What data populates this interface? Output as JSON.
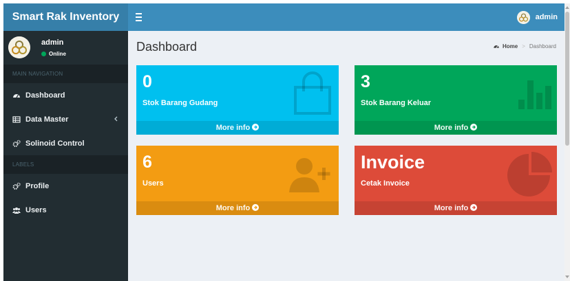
{
  "header": {
    "logo": "Smart Rak Inventory",
    "user_name": "admin"
  },
  "sidebar": {
    "user_name": "admin",
    "user_status": "Online",
    "sections": [
      {
        "title": "MAIN NAVIGATION"
      },
      {
        "title": "LABELS"
      }
    ],
    "items": [
      {
        "label": "Dashboard",
        "icon": "dashboard-icon"
      },
      {
        "label": "Data Master",
        "icon": "table-icon"
      },
      {
        "label": "Solinoid Control",
        "icon": "cogs-icon"
      },
      {
        "label": "Profile",
        "icon": "cogs-icon"
      },
      {
        "label": "Users",
        "icon": "users-icon"
      }
    ]
  },
  "content": {
    "title": "Dashboard",
    "breadcrumb": {
      "home": "Home",
      "current": "Dashboard"
    },
    "boxes": [
      {
        "value": "0",
        "label": "Stok Barang Gudang",
        "footer": "More info",
        "color": "#00c0ef",
        "icon": "shopping-bag-icon"
      },
      {
        "value": "3",
        "label": "Stok Barang Keluar",
        "footer": "More info",
        "color": "#00a65a",
        "icon": "bar-chart-icon"
      },
      {
        "value": "6",
        "label": "Users",
        "footer": "More info",
        "color": "#f39c12",
        "icon": "user-plus-icon"
      },
      {
        "value": "Invoice",
        "label": "Cetak Invoice",
        "footer": "More info",
        "color": "#dd4b39",
        "icon": "pie-chart-icon"
      }
    ]
  },
  "colors": {
    "header": "#3c8dbc",
    "logo_bg": "#367fa9",
    "sidebar": "#222d32",
    "content_bg": "#ecf0f5"
  }
}
